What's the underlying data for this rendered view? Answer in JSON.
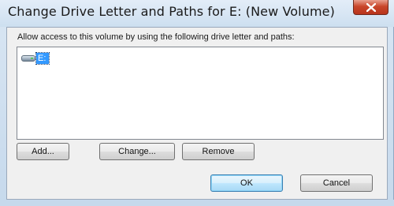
{
  "window": {
    "title": "Change Drive Letter and Paths for E: (New Volume)"
  },
  "dialog": {
    "instruction": "Allow access to this volume by using the following drive letter and paths:",
    "list_items": [
      {
        "label": "E:",
        "icon": "drive-icon",
        "selected": true
      }
    ],
    "buttons": {
      "add": "Add...",
      "change": "Change...",
      "remove": "Remove",
      "ok": "OK",
      "cancel": "Cancel"
    }
  },
  "colors": {
    "selection": "#3399ff",
    "close_button": "#c9462b"
  }
}
